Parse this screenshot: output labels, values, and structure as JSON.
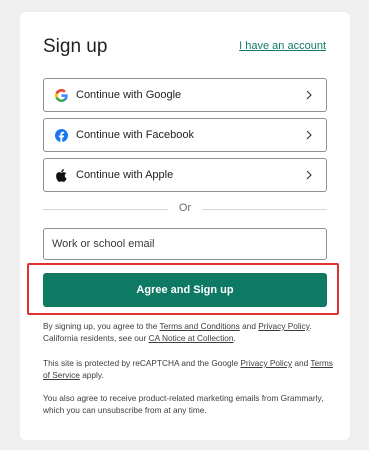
{
  "header": {
    "title": "Sign up",
    "account_link": "I have an account"
  },
  "social": [
    {
      "label": "Continue with Google",
      "icon": "google-icon"
    },
    {
      "label": "Continue with Facebook",
      "icon": "facebook-icon"
    },
    {
      "label": "Continue with Apple",
      "icon": "apple-icon"
    }
  ],
  "divider": {
    "text": "Or"
  },
  "email": {
    "placeholder": "Work or school email",
    "value": ""
  },
  "submit": {
    "label": "Agree and Sign up"
  },
  "legal": {
    "p1": {
      "t1": "By signing up, you agree to the ",
      "l1": "Terms and Conditions",
      "t2": " and ",
      "l2": "Privacy Policy",
      "t3": ". California residents, see our ",
      "l3": "CA Notice at Collection",
      "t4": "."
    },
    "p2": {
      "t1": "This site is protected by reCAPTCHA and the Google ",
      "l1": "Privacy Policy",
      "t2": " and ",
      "l2": "Terms of Service",
      "t3": " apply."
    },
    "p3": "You also agree to receive product-related marketing emails from Grammarly, which you can unsubscribe from at any time."
  },
  "colors": {
    "brand": "#0e7a64",
    "highlight": "#e03131",
    "facebook": "#1877f2"
  }
}
